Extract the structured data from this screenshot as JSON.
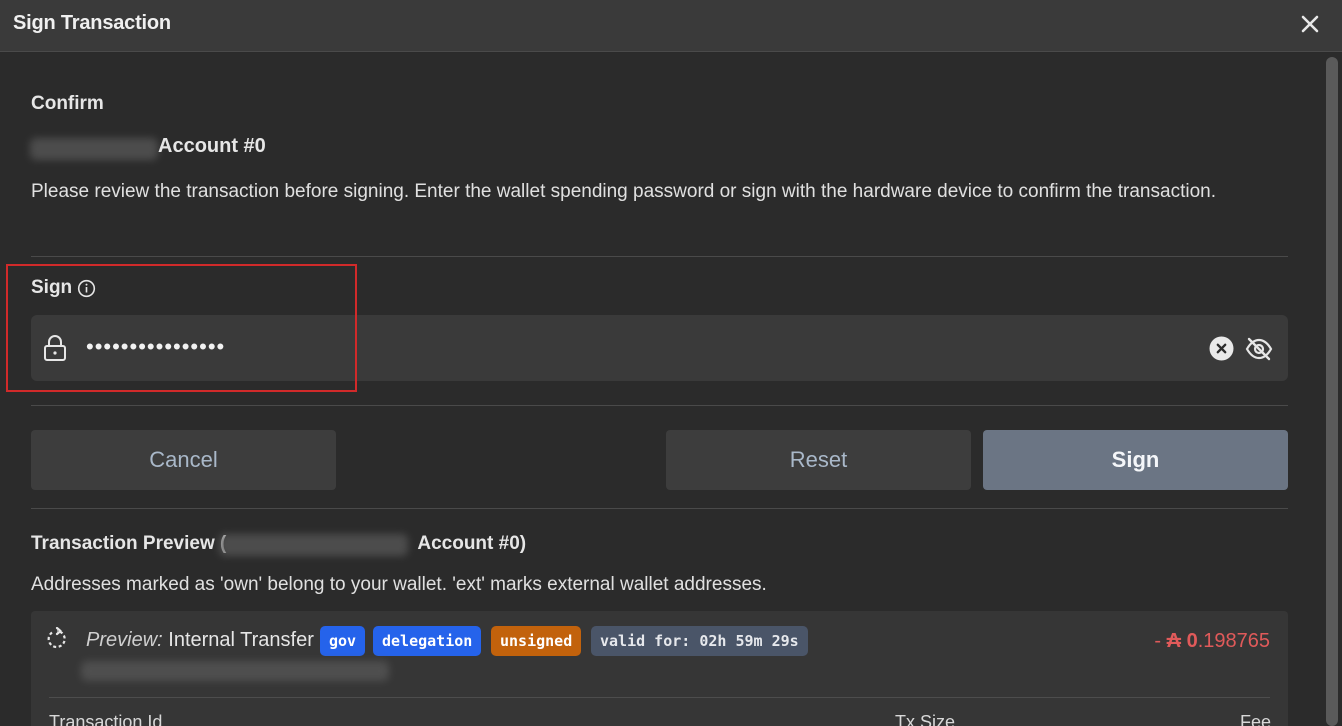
{
  "window": {
    "title": "Sign Transaction",
    "close_icon": "close-icon"
  },
  "confirm": {
    "heading": "Confirm",
    "account": "Account #0",
    "description": "Please review the transaction before signing. Enter the wallet spending password or sign with the hardware device to confirm the transaction."
  },
  "sign": {
    "label": "Sign",
    "password_value": "••••••••••••••••"
  },
  "buttons": {
    "cancel": "Cancel",
    "reset": "Reset",
    "sign": "Sign"
  },
  "preview": {
    "title_prefix": "Transaction Preview (",
    "title_suffix": "Account #0)",
    "description": "Addresses marked as 'own' belong to your wallet. 'ext' marks external wallet addresses.",
    "card": {
      "label_italic": "Preview:",
      "label": "Internal Transfer",
      "badges": [
        "gov",
        "delegation",
        "unsigned",
        "valid for: 02h 59m 29s"
      ],
      "amount_sign": "-",
      "amount_symbol": "₳",
      "amount_int": "0",
      "amount_dec": ".198765",
      "columns": [
        "Transaction Id",
        "Tx Size",
        "Fee"
      ]
    }
  },
  "colors": {
    "highlight": "#d12a2a",
    "badge_blue": "#2563eb",
    "badge_orange": "#c2620c",
    "negative_amount": "#e05a5a"
  }
}
